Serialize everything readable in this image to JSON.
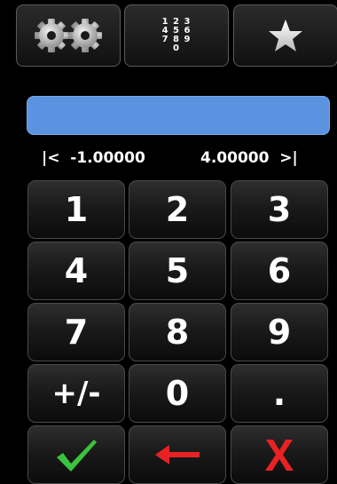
{
  "top_bar": {
    "settings_icon": "gears-icon",
    "keypad_icon_label": "1 2 3\n4 5 6\n7 8 9\n0",
    "favorite_icon": "star-icon"
  },
  "entry": {
    "value": "",
    "bar_color": "#5b93e0"
  },
  "range": {
    "min_label": "|<  -1.00000",
    "max_label": "4.00000  >|"
  },
  "keypad": {
    "k1": "1",
    "k2": "2",
    "k3": "3",
    "k4": "4",
    "k5": "5",
    "k6": "6",
    "k7": "7",
    "k8": "8",
    "k9": "9",
    "sign": "+/-",
    "k0": "0",
    "dot": "."
  },
  "actions": {
    "confirm_icon": "checkmark-icon",
    "backspace_icon": "left-arrow-icon",
    "cancel_icon": "x-icon",
    "confirm_color": "#3cc23c",
    "backspace_color": "#e82222",
    "cancel_color": "#e82222"
  }
}
